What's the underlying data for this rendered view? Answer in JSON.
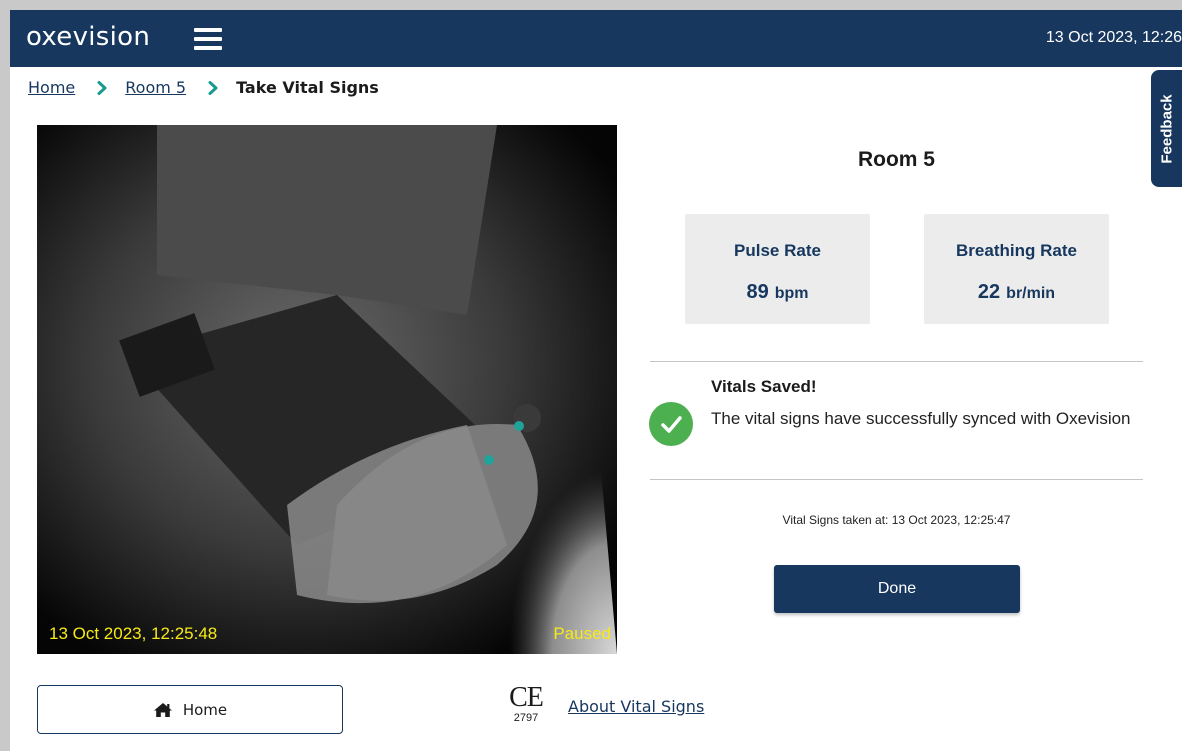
{
  "app": {
    "brand": "oxevision",
    "clock": "13 Oct 2023, 12:26"
  },
  "breadcrumb": {
    "items": [
      "Home",
      "Room 5"
    ],
    "current": "Take Vital Signs"
  },
  "feedback": {
    "label": "Feedback"
  },
  "video": {
    "timestamp": "13 Oct 2023, 12:25:48",
    "status": "Paused"
  },
  "room": {
    "title": "Room 5"
  },
  "vitals": {
    "pulse": {
      "label": "Pulse Rate",
      "value": "89",
      "unit": "bpm"
    },
    "breathing": {
      "label": "Breathing Rate",
      "value": "22",
      "unit": "br/min"
    }
  },
  "saved": {
    "title": "Vitals Saved!",
    "message": "The vital signs have successfully synced with Oxevision"
  },
  "taken_at": "Vital Signs taken at: 13 Oct 2023, 12:25:47",
  "actions": {
    "done": "Done",
    "home": "Home"
  },
  "footer": {
    "ce_letters": "CE",
    "ce_number": "2797",
    "about_link": "About Vital Signs"
  },
  "colors": {
    "navy": "#17375e",
    "success": "#4caf50",
    "overlay_text": "#f7ea16"
  },
  "icons": {
    "menu": "hamburger-icon",
    "chevron": "chevron-right-icon",
    "check": "check-icon",
    "home": "home-icon"
  }
}
